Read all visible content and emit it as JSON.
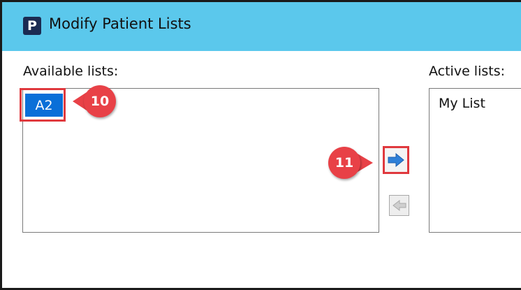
{
  "window": {
    "app_icon_letter": "P",
    "title": "Modify Patient Lists"
  },
  "available": {
    "label": "Available lists:",
    "items": [
      "A2"
    ]
  },
  "active": {
    "label": "Active lists:",
    "items": [
      "My List"
    ]
  },
  "buttons": {
    "add_icon": "right-arrow-icon",
    "remove_icon": "left-arrow-icon"
  },
  "callouts": [
    {
      "number": "10"
    },
    {
      "number": "11"
    }
  ],
  "colors": {
    "titlebar": "#5bc8ec",
    "selection": "#0a6fd8",
    "callout": "#e84147",
    "highlight_border": "#e0393e",
    "arrow_blue": "#2f80d8"
  }
}
